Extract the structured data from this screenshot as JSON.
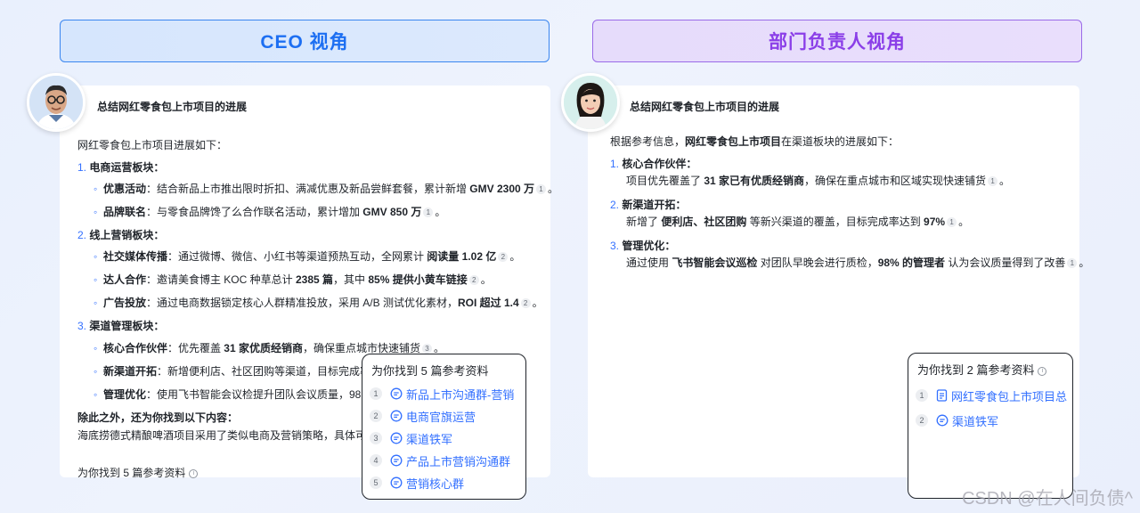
{
  "headers": {
    "ceo": "CEO 视角",
    "dept": "部门负责人视角"
  },
  "question": "总结网红零食包上市项目的进展",
  "ceo": {
    "intro": "网红零食包上市项目进展如下：",
    "sections": [
      {
        "num": "1.",
        "title": "电商运营板块："
      },
      {
        "num": "2.",
        "title": "线上营销板块："
      },
      {
        "num": "3.",
        "title": "渠道管理板块："
      }
    ],
    "s1a": {
      "label": "优惠活动",
      "text": "：结合新品上市推出限时折扣、满减优惠及新品尝鲜套餐，累计新增 ",
      "bold": "GMV 2300 万",
      "cite": "1",
      "end": "。"
    },
    "s1b": {
      "label": "品牌联名",
      "text": "：与零食品牌馋了么合作联名活动，累计增加 ",
      "bold": "GMV 850 万",
      "cite": "1",
      "end": "。"
    },
    "s2a": {
      "label": "社交媒体传播",
      "text": "：通过微博、微信、小红书等渠道预热互动，全网累计 ",
      "bold": "阅读量 1.02 亿",
      "cite": "2",
      "end": "。"
    },
    "s2b": {
      "label": "达人合作",
      "text": "：邀请美食博主 KOC 种草总计 ",
      "bold": "2385 篇",
      "text2": "，其中 ",
      "bold2": "85% 提供小黄车链接",
      "cite": "2",
      "end": "。"
    },
    "s2c": {
      "label": "广告投放",
      "text": "：通过电商数据锁定核心人群精准投放，采用 A/B 测试优化素材，",
      "bold": "ROI 超过 1.4",
      "cite": "2",
      "end": "。"
    },
    "s3a": {
      "label": "核心合作伙伴",
      "text": "：优先覆盖 ",
      "bold": "31 家优质经销商",
      "text2": "，确保重点城市快速铺货",
      "cite": "3",
      "end": "。"
    },
    "s3b": {
      "label": "新渠道开拓",
      "text": "：新增便利店、社区团购等渠道，目标完成率"
    },
    "s3c": {
      "label": "管理优化",
      "text": "：使用飞书智能会议检提升团队会议质量，98"
    },
    "extra_title": "除此之外，还为你找到以下内容：",
    "extra_text": "海底捞德式精酿啤酒项目采用了类似电商及营销策略，具体可参",
    "footer": "为你找到 5 篇参考资料"
  },
  "ceo_popup": {
    "title": "为你找到 5 篇参考资料",
    "items": [
      {
        "idx": "1",
        "label": "新品上市沟通群-营销"
      },
      {
        "idx": "2",
        "label": "电商官旗运营"
      },
      {
        "idx": "3",
        "label": "渠道铁军"
      },
      {
        "idx": "4",
        "label": "产品上市营销沟通群"
      },
      {
        "idx": "5",
        "label": "营销核心群"
      }
    ]
  },
  "dept": {
    "intro_a": "根据参考信息，",
    "intro_b": "网红零食包上市项目",
    "intro_c": "在渠道板块的进展如下：",
    "sections": [
      {
        "num": "1.",
        "title": "核心合作伙伴："
      },
      {
        "num": "2.",
        "title": "新渠道开拓："
      },
      {
        "num": "3.",
        "title": "管理优化："
      }
    ],
    "p1": {
      "text": "项目优先覆盖了 ",
      "bold": "31 家已有优质经销商",
      "text2": "，确保在重点城市和区域实现快速铺货",
      "cite": "1",
      "end": "。"
    },
    "p2": {
      "text": "新增了 ",
      "bold": "便利店、社区团购",
      "text2": " 等新兴渠道的覆盖，目标完成率达到 ",
      "bold2": "97%",
      "cite": "1",
      "end": "。"
    },
    "p3": {
      "text": "通过使用 ",
      "bold": "飞书智能会议巡检",
      "text2": " 对团队早晚会进行质检，",
      "bold2": "98% 的管理者",
      "text3": " 认为会议质量得到了改善",
      "cite": "1",
      "end": "。"
    }
  },
  "dept_popup": {
    "title": "为你找到 2 篇参考资料",
    "items": [
      {
        "idx": "1",
        "label": "网红零食包上市项目总"
      },
      {
        "idx": "2",
        "label": "渠道铁军"
      }
    ]
  },
  "watermark": "CSDN @在人间负债^",
  "colors": {
    "ceo_accent": "#1d6ff2",
    "dept_accent": "#8b3fe8",
    "link": "#3370ff"
  }
}
